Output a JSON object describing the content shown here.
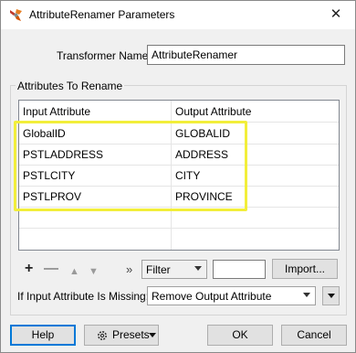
{
  "window": {
    "title": "AttributeRenamer Parameters",
    "close_glyph": "✕"
  },
  "transformer_name": {
    "label": "Transformer Name:",
    "value": "AttributeRenamer"
  },
  "attributes_group": {
    "title": "Attributes To Rename",
    "columns": [
      "Input Attribute",
      "Output Attribute"
    ],
    "rows": [
      {
        "input": "GlobalID",
        "output": "GLOBALID"
      },
      {
        "input": "PSTLADDRESS",
        "output": "ADDRESS"
      },
      {
        "input": "PSTLCITY",
        "output": "CITY"
      },
      {
        "input": "PSTLPROV",
        "output": "PROVINCE"
      }
    ]
  },
  "toolbar": {
    "add_glyph": "+",
    "remove_glyph": "—",
    "up_glyph": "▲",
    "down_glyph": "▼",
    "more_glyph": "»",
    "filter_value": "Filter",
    "filter_text": "",
    "import_label": "Import..."
  },
  "missing": {
    "label": "If Input Attribute Is Missing:",
    "value": "Remove Output Attribute"
  },
  "buttons": {
    "help": "Help",
    "presets": "Presets",
    "ok": "OK",
    "cancel": "Cancel"
  },
  "colors": {
    "highlight": "#f2ee3a",
    "default_button_border": "#0078d7"
  }
}
